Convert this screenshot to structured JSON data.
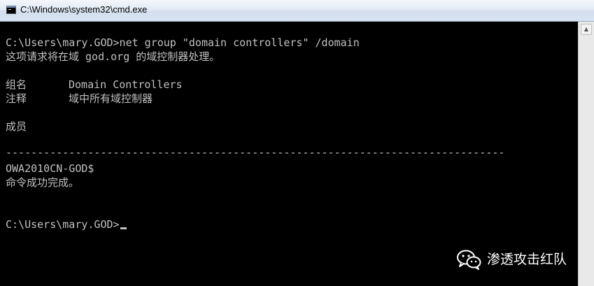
{
  "window": {
    "title": "C:\\Windows\\system32\\cmd.exe"
  },
  "console": {
    "command_line": "C:\\Users\\mary.GOD>net group \"domain controllers\" /domain",
    "request_note": "这项请求将在域 god.org 的域控制器处理。",
    "group_name_label": "组名",
    "group_name_value": "Domain Controllers",
    "comment_label": "注释",
    "comment_value": "域中所有域控制器",
    "members_label": "成员",
    "divider": "-------------------------------------------------------------------------------",
    "member_1": "OWA2010CN-GOD$",
    "completion": "命令成功完成。",
    "prompt": "C:\\Users\\mary.GOD>"
  },
  "watermark": {
    "text": "渗透攻击红队",
    "icon": "wechat-icon"
  },
  "colors": {
    "console_bg": "#000000",
    "console_text": "#c0c0c0"
  }
}
